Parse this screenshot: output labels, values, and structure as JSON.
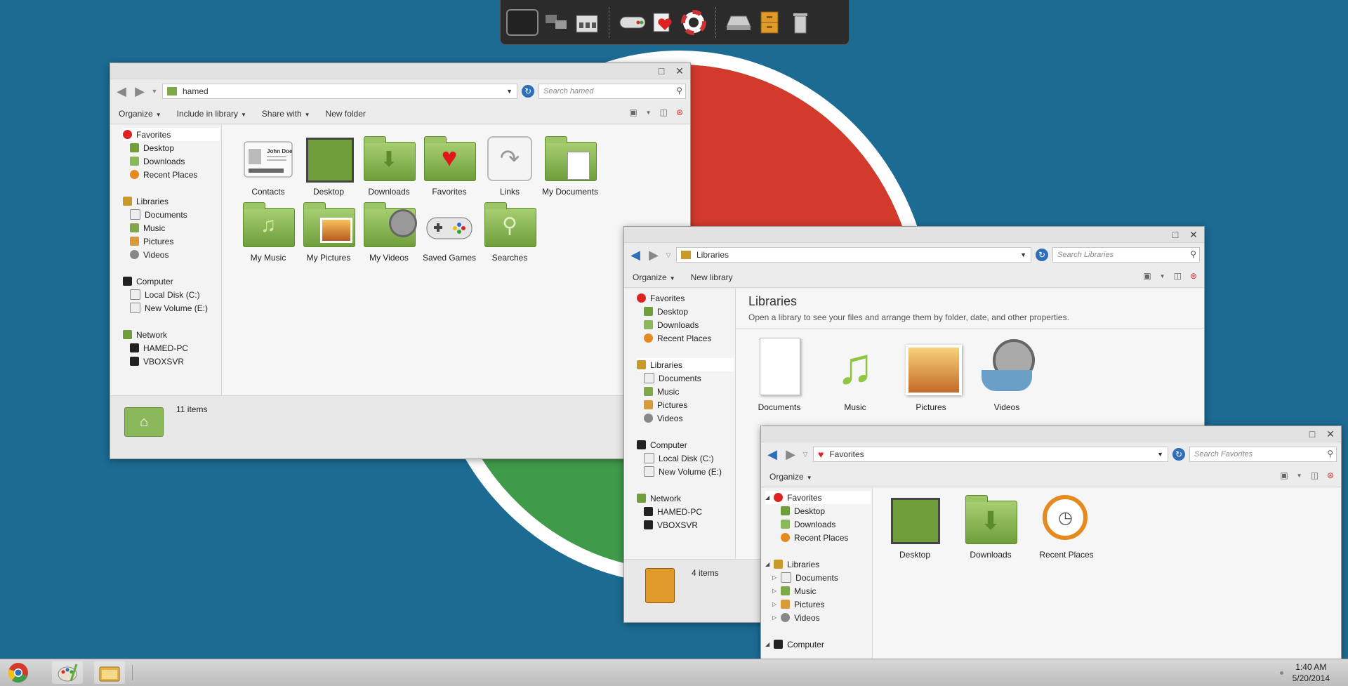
{
  "dock": {
    "icons": [
      "monitor-icon",
      "network-icon",
      "cabinet-icon",
      "gamepad-icon",
      "favorites-book-icon",
      "help-lifebuoy-icon",
      "drive-icon",
      "file-cabinet-icon",
      "trash-icon"
    ]
  },
  "win1": {
    "address": "hamed",
    "search_placeholder": "Search hamed",
    "toolbar": {
      "organize": "Organize",
      "include": "Include in library",
      "share": "Share with",
      "new_folder": "New folder"
    },
    "nav": {
      "favorites": "Favorites",
      "desktop": "Desktop",
      "downloads": "Downloads",
      "recent": "Recent Places",
      "libraries": "Libraries",
      "documents": "Documents",
      "music": "Music",
      "pictures": "Pictures",
      "videos": "Videos",
      "computer": "Computer",
      "local_disk": "Local Disk (C:)",
      "new_volume": "New Volume (E:)",
      "network": "Network",
      "hamed_pc": "HAMED-PC",
      "vboxsvr": "VBOXSVR"
    },
    "items": [
      "Contacts",
      "Desktop",
      "Downloads",
      "Favorites",
      "Links",
      "My Documents",
      "My Music",
      "My Pictures",
      "My Videos",
      "Saved Games",
      "Searches"
    ],
    "contact_card_text": "John Doe",
    "status": "11 items"
  },
  "win2": {
    "address": "Libraries",
    "search_placeholder": "Search Libraries",
    "toolbar": {
      "organize": "Organize",
      "new_library": "New library"
    },
    "nav": {
      "favorites": "Favorites",
      "desktop": "Desktop",
      "downloads": "Downloads",
      "recent": "Recent Places",
      "libraries": "Libraries",
      "documents": "Documents",
      "music": "Music",
      "pictures": "Pictures",
      "videos": "Videos",
      "computer": "Computer",
      "local_disk": "Local Disk (C:)",
      "new_volume": "New Volume (E:)",
      "network": "Network",
      "hamed_pc": "HAMED-PC",
      "vboxsvr": "VBOXSVR"
    },
    "heading": "Libraries",
    "subheading": "Open a library to see your files and arrange them by folder, date, and other properties.",
    "items": [
      "Documents",
      "Music",
      "Pictures",
      "Videos"
    ],
    "status": "4 items"
  },
  "win3": {
    "address": "Favorites",
    "search_placeholder": "Search Favorites",
    "toolbar": {
      "organize": "Organize"
    },
    "nav": {
      "favorites": "Favorites",
      "desktop": "Desktop",
      "downloads": "Downloads",
      "recent": "Recent Places",
      "libraries": "Libraries",
      "documents": "Documents",
      "music": "Music",
      "pictures": "Pictures",
      "videos": "Videos",
      "computer": "Computer"
    },
    "items": [
      "Desktop",
      "Downloads",
      "Recent Places"
    ]
  },
  "taskbar": {
    "time": "1:40 AM",
    "date": "5/20/2014"
  }
}
